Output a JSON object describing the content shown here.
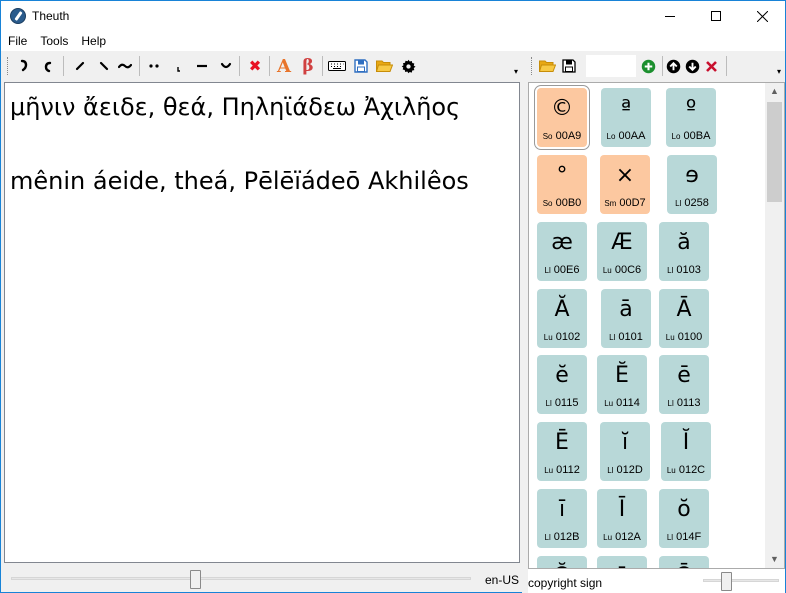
{
  "window": {
    "title": "Theuth"
  },
  "menu": [
    {
      "label": "File"
    },
    {
      "label": "Tools"
    },
    {
      "label": "Help"
    }
  ],
  "toolbar": {
    "diacritics": [
      {
        "glyph": "̓",
        "icon": "smooth-breathing-icon"
      },
      {
        "glyph": "̔",
        "icon": "rough-breathing-icon"
      },
      {
        "glyph": "́",
        "icon": "acute-accent-icon"
      },
      {
        "glyph": "̀",
        "icon": "grave-accent-icon"
      },
      {
        "glyph": "͂",
        "icon": "circumflex-icon"
      },
      {
        "glyph": "̈",
        "icon": "diaeresis-icon"
      },
      {
        "glyph": "ͅ",
        "icon": "iota-subscript-icon"
      },
      {
        "glyph": "̄",
        "icon": "macron-icon"
      },
      {
        "glyph": "̆",
        "icon": "breve-icon"
      }
    ],
    "remove_glyph": "✖",
    "font_glyph": "A",
    "greek_glyph": "β",
    "colors": {
      "remove": "#e81123",
      "font": "#e8742a",
      "greek": "#d04040",
      "save": "#2f6fc1",
      "folder": "#f2b71f"
    }
  },
  "editor": {
    "lines": [
      "μῆνιν ἄειδε, θεά, Πηληϊάδεω Ἀχιλῆος",
      "mênin áeide, theá, Pēlēïádeō Akhilêos"
    ]
  },
  "panel_toolbar": {
    "search_value": "",
    "colors": {
      "add": "#1b8f2e",
      "delete": "#c8102e",
      "nav": "#000000"
    }
  },
  "characters": [
    [
      {
        "glyph": "©",
        "cat": "So",
        "code": "00A9",
        "kind": "S",
        "selected": true
      },
      {
        "glyph": "ª",
        "cat": "Lo",
        "code": "00AA",
        "kind": "L"
      },
      {
        "glyph": "º",
        "cat": "Lo",
        "code": "00BA",
        "kind": "L"
      }
    ],
    [
      {
        "glyph": "°",
        "cat": "So",
        "code": "00B0",
        "kind": "S"
      },
      {
        "glyph": "×",
        "cat": "Sm",
        "code": "00D7",
        "kind": "S"
      },
      {
        "glyph": "ɘ",
        "cat": "Ll",
        "code": "0258",
        "kind": "L"
      }
    ],
    [
      {
        "glyph": "æ",
        "cat": "Ll",
        "code": "00E6",
        "kind": "L"
      },
      {
        "glyph": "Æ",
        "cat": "Lu",
        "code": "00C6",
        "kind": "L"
      },
      {
        "glyph": "ă",
        "cat": "Ll",
        "code": "0103",
        "kind": "L"
      }
    ],
    [
      {
        "glyph": "Ă",
        "cat": "Lu",
        "code": "0102",
        "kind": "L"
      },
      {
        "glyph": "ā",
        "cat": "Ll",
        "code": "0101",
        "kind": "L"
      },
      {
        "glyph": "Ā",
        "cat": "Lu",
        "code": "0100",
        "kind": "L"
      }
    ],
    [
      {
        "glyph": "ĕ",
        "cat": "Ll",
        "code": "0115",
        "kind": "L"
      },
      {
        "glyph": "Ĕ",
        "cat": "Lu",
        "code": "0114",
        "kind": "L"
      },
      {
        "glyph": "ē",
        "cat": "Ll",
        "code": "0113",
        "kind": "L"
      }
    ],
    [
      {
        "glyph": "Ē",
        "cat": "Lu",
        "code": "0112",
        "kind": "L"
      },
      {
        "glyph": "ĭ",
        "cat": "Ll",
        "code": "012D",
        "kind": "L"
      },
      {
        "glyph": "Ĭ",
        "cat": "Lu",
        "code": "012C",
        "kind": "L"
      }
    ],
    [
      {
        "glyph": "ī",
        "cat": "Ll",
        "code": "012B",
        "kind": "L"
      },
      {
        "glyph": "Ī",
        "cat": "Lu",
        "code": "012A",
        "kind": "L"
      },
      {
        "glyph": "ŏ",
        "cat": "Ll",
        "code": "014F",
        "kind": "L"
      }
    ],
    [
      {
        "glyph": "Ŏ",
        "cat": "",
        "code": "",
        "kind": "L"
      },
      {
        "glyph": "ō",
        "cat": "",
        "code": "",
        "kind": "L"
      },
      {
        "glyph": "Ō",
        "cat": "",
        "code": "",
        "kind": "L"
      }
    ]
  ],
  "status": {
    "locale": "en-US",
    "selected_char_name": "copyright sign",
    "font_size_level": 0.4,
    "tile_size_level": 0.3
  }
}
